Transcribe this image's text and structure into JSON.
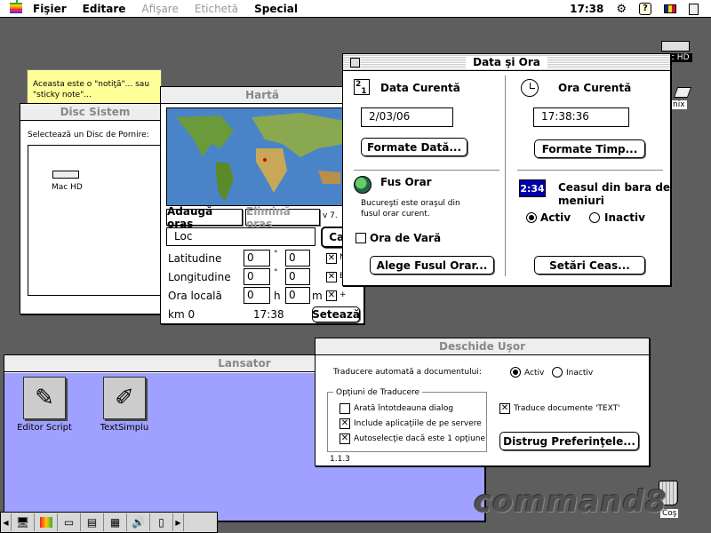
{
  "menubar": {
    "items": [
      {
        "label": "Fişier",
        "enabled": true
      },
      {
        "label": "Editare",
        "enabled": true
      },
      {
        "label": "Afişare",
        "enabled": false
      },
      {
        "label": "Etichetă",
        "enabled": false
      },
      {
        "label": "Special",
        "enabled": true
      }
    ],
    "clock": "17:38"
  },
  "desktop": {
    "disk_label_right": "c HD",
    "disk_label_right2": "nix",
    "trash_label": "Coş",
    "watermark": "command8"
  },
  "sticky": {
    "text_line1": "Aceasta este o \"notiţă\"... sau",
    "text_line2": "\"sticky note\"..."
  },
  "disc_sistem": {
    "title": "Disc Sistem",
    "prompt": "Selectează un Disc de Pornire:",
    "disk_name": "Mac HD"
  },
  "harta": {
    "title": "Hartă",
    "add_button": "Adaugă oraş",
    "remove_button": "Elimină oraş",
    "version": "v 7.",
    "location_value": "Loc",
    "find_button": "Cau",
    "latitude_label": "Latitudine",
    "longitude_label": "Longitudine",
    "local_time_label": "Ora locală",
    "lat_deg": "0",
    "lat_min": "0",
    "lon_deg": "0",
    "lon_min": "0",
    "time_h": "0",
    "time_m": "0",
    "deg_symbol": "°",
    "min_symbol": "′",
    "h_unit": "h",
    "m_unit": "m",
    "plus": "+",
    "km_label": "km 0",
    "time_value": "17:38",
    "set_button": "Setează",
    "n_letter": "N",
    "e_letter": "E"
  },
  "data_ora": {
    "title": "Data şi Ora",
    "current_date_label": "Data Curentă",
    "current_date_value": "2/03/06",
    "date_formats_button": "Formate Dată...",
    "current_time_label": "Ora Curentă",
    "current_time_value": "17:38:36",
    "time_formats_button": "Formate Timp...",
    "timezone_label": "Fus Orar",
    "timezone_desc_line1": "Bucureşti este oraşul din",
    "timezone_desc_line2": "fusul orar curent.",
    "dst_label": "Ora de Vară",
    "choose_tz_button": "Alege Fusul Orar...",
    "menubar_clock_label_line1": "Ceasul din bara de",
    "menubar_clock_label_line2": "meniuri",
    "clock_icon_text": "2:34",
    "active_label": "Activ",
    "inactive_label": "Inactiv",
    "clock_settings_button": "Setări Ceas...",
    "clock_active": true
  },
  "deschide_usor": {
    "title": "Deschide Uşor",
    "auto_translate_label": "Traducere automată a documentului:",
    "active_label": "Activ",
    "inactive_label": "Inactiv",
    "options_group_label": "Opţiuni de Traducere",
    "option1": "Arată întotdeauna dialog",
    "option2": "Include aplicaţiile de pe servere",
    "option3": "Autoselecţie dacă este 1 opţiune",
    "option1_checked": false,
    "option2_checked": true,
    "option3_checked": true,
    "translate_text_label": "Traduce documente 'TEXT'",
    "translate_text_checked": true,
    "destroy_prefs_button": "Distrug Preferinţele...",
    "version": "1.1.3"
  },
  "lansator": {
    "title": "Lansator",
    "items": [
      {
        "label": "Editor Script",
        "icon": "script-editor-icon"
      },
      {
        "label": "TextSimplu",
        "icon": "simpletext-icon"
      }
    ]
  },
  "colors": {
    "desktop": "#5e5e5e",
    "launcher": "#9fa0ff",
    "sticky": "#ffff99",
    "clock_icon": "#0000aa"
  }
}
